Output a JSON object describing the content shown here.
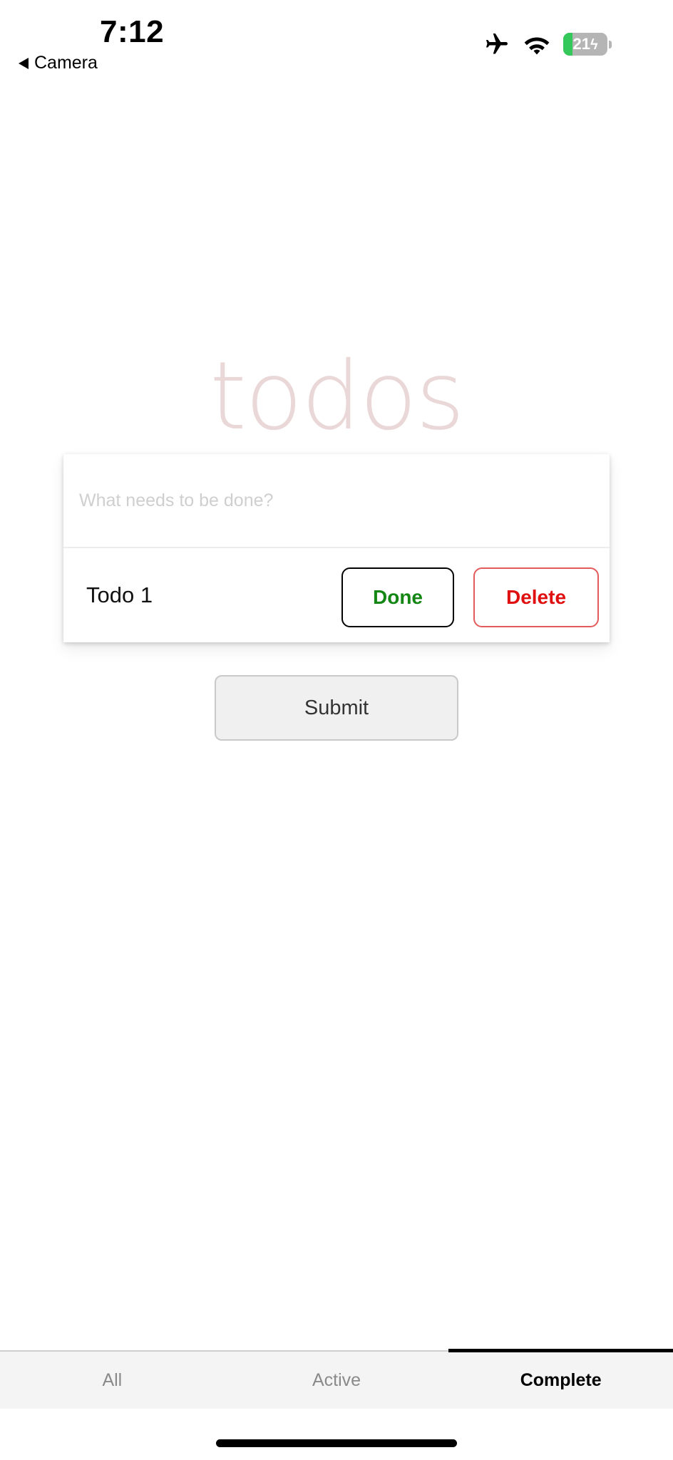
{
  "status_bar": {
    "time": "7:12",
    "back_label": "Camera",
    "battery_level": "21",
    "battery_fraction": 0.21,
    "icons": [
      "airplane-icon",
      "wifi-icon",
      "battery-icon"
    ]
  },
  "app": {
    "title": "todos"
  },
  "new_todo": {
    "placeholder": "What needs to be done?",
    "value": ""
  },
  "todos": [
    {
      "text": "Todo 1",
      "done_label": "Done",
      "delete_label": "Delete"
    }
  ],
  "submit_label": "Submit",
  "tabs": [
    {
      "label": "All",
      "active": false
    },
    {
      "label": "Active",
      "active": false
    },
    {
      "label": "Complete",
      "active": true
    }
  ],
  "colors": {
    "title": "#ead7d7",
    "done_text": "#138613",
    "delete_text": "#e01010",
    "delete_border": "#e45959",
    "battery_fill": "#34c759"
  }
}
